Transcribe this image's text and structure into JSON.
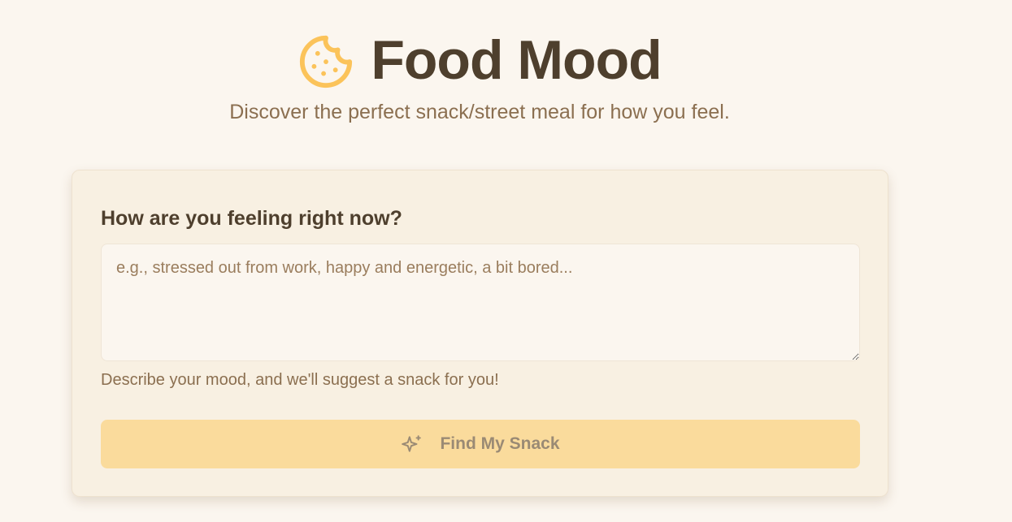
{
  "header": {
    "title": "Food Mood",
    "subtitle": "Discover the perfect snack/street meal for how you feel.",
    "logo_icon": "cookie-icon"
  },
  "form": {
    "question": "How are you feeling right now?",
    "mood_input_value": "",
    "mood_input_placeholder": "e.g., stressed out from work, happy and energetic, a bit bored...",
    "hint": "Describe your mood, and we'll suggest a snack for you!",
    "submit_label": "Find My Snack",
    "submit_icon": "sparkles-icon",
    "submit_disabled": true
  },
  "colors": {
    "background": "#fbf6ef",
    "card": "#f8f0e2",
    "accent": "#fbc35a",
    "button_disabled": "#fadb9c",
    "text_dark": "#4e3f2d",
    "text_muted": "#8b6f50"
  }
}
